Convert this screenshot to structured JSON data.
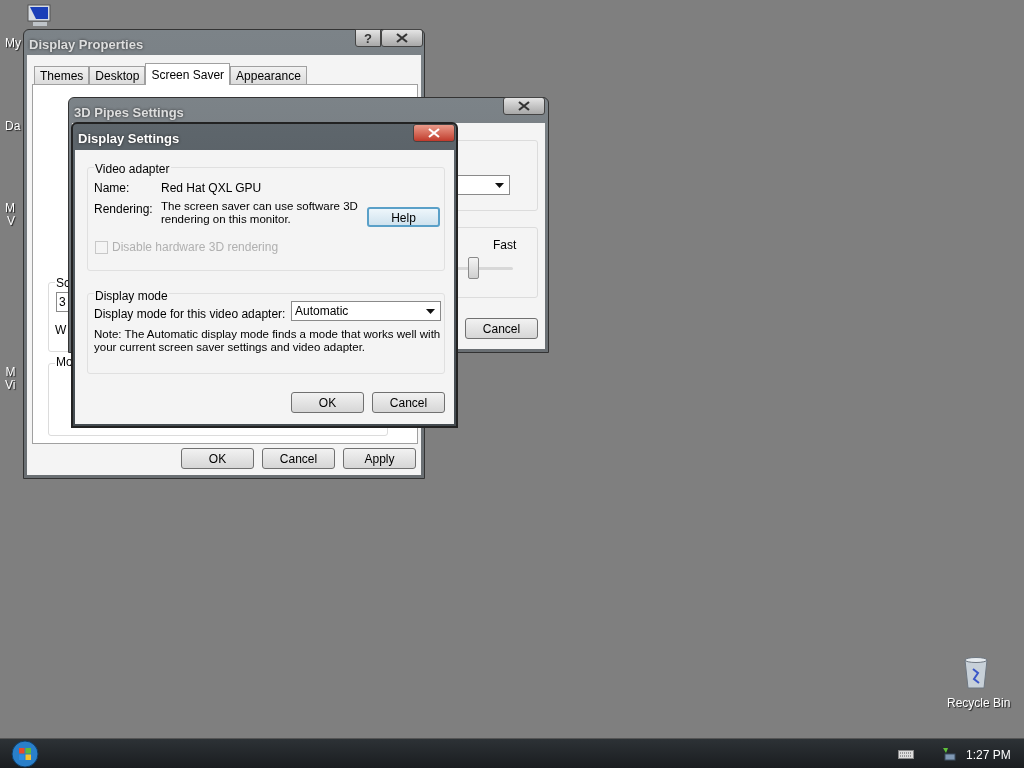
{
  "desktop": {
    "left_icons": [
      {
        "kind": "computer",
        "lines": [
          "My"
        ]
      },
      {
        "kind": "hidden",
        "lines": [
          "Da"
        ]
      },
      {
        "kind": "hidden",
        "lines": [
          "M",
          "V"
        ]
      },
      {
        "kind": "hidden",
        "lines": [
          "M",
          "Vi"
        ]
      }
    ],
    "recycle_bin": {
      "label": "Recycle Bin"
    }
  },
  "display_properties": {
    "title": "Display Properties",
    "help_button": "?",
    "tabs": [
      {
        "label": "Themes",
        "selected": false
      },
      {
        "label": "Desktop",
        "selected": false
      },
      {
        "label": "Screen Saver",
        "selected": true
      },
      {
        "label": "Appearance",
        "selected": false
      }
    ],
    "screen_saver_group": {
      "heading": "Sc",
      "select_value": "3",
      "wait_label": "W"
    },
    "monitor_power_group": {
      "heading": "Mo"
    },
    "buttons": [
      "OK",
      "Cancel",
      "Apply"
    ]
  },
  "pipes_settings": {
    "title": "3D Pipes Settings",
    "speed": {
      "label": "Fast",
      "level": 0.7
    },
    "buttons": [
      "Cancel"
    ]
  },
  "display_settings": {
    "title": "Display Settings",
    "video_adapter": {
      "heading": "Video adapter",
      "name_label": "Name:",
      "name_value": "Red Hat QXL GPU",
      "rendering_label": "Rendering:",
      "rendering_text": "The screen saver can use software 3D rendering on this monitor.",
      "help_button": "Help",
      "disable_hardware": {
        "label": "Disable hardware 3D rendering",
        "checked": false,
        "disabled": true
      }
    },
    "display_mode": {
      "heading": "Display mode",
      "label": "Display mode for this video adapter:",
      "select_value": "Automatic",
      "note": "Note: The Automatic display mode finds a mode that works well with your current screen saver settings and video adapter."
    },
    "buttons": [
      "OK",
      "Cancel"
    ]
  },
  "taskbar": {
    "clock": "1:27 PM"
  }
}
